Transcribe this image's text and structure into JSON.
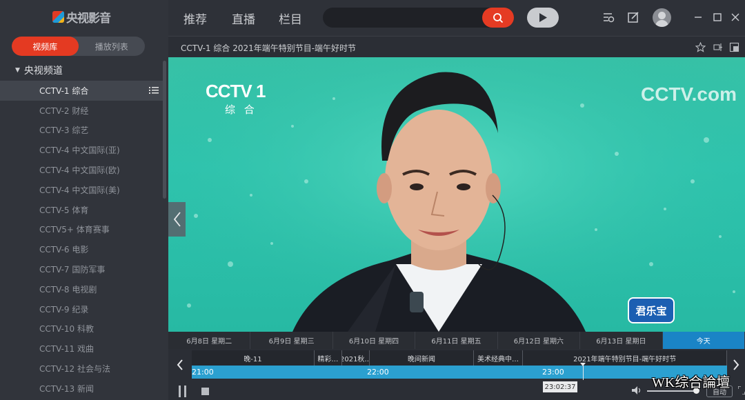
{
  "app": {
    "logo_text": "央视影音"
  },
  "sidebar": {
    "tabs": [
      {
        "label": "视频库",
        "active": true
      },
      {
        "label": "播放列表",
        "active": false
      }
    ],
    "group": "央视频道",
    "channels": [
      {
        "label": "CCTV-1 综合",
        "active": true
      },
      {
        "label": "CCTV-2 财经"
      },
      {
        "label": "CCTV-3 综艺"
      },
      {
        "label": "CCTV-4 中文国际(亚)"
      },
      {
        "label": "CCTV-4 中文国际(欧)"
      },
      {
        "label": "CCTV-4 中文国际(美)"
      },
      {
        "label": "CCTV-5 体育"
      },
      {
        "label": "CCTV5+ 体育赛事"
      },
      {
        "label": "CCTV-6 电影"
      },
      {
        "label": "CCTV-7 国防军事"
      },
      {
        "label": "CCTV-8 电视剧"
      },
      {
        "label": "CCTV-9 纪录"
      },
      {
        "label": "CCTV-10 科教"
      },
      {
        "label": "CCTV-11 戏曲"
      },
      {
        "label": "CCTV-12 社会与法"
      },
      {
        "label": "CCTV-13 新闻"
      }
    ]
  },
  "topnav": {
    "items": [
      "推荐",
      "直播",
      "栏目"
    ]
  },
  "player": {
    "title": "CCTV-1 综合 2021年端午特别节目-端午好时节",
    "watermark_channel": "CCTV 1",
    "watermark_sub": "综 合",
    "watermark_right": "CCTV.com",
    "brand_badge": "君乐宝"
  },
  "timeline": {
    "dates": [
      {
        "label": "6月8日 星期二"
      },
      {
        "label": "6月9日 星期三"
      },
      {
        "label": "6月10日 星期四"
      },
      {
        "label": "6月11日 星期五"
      },
      {
        "label": "6月12日 星期六"
      },
      {
        "label": "6月13日 星期日"
      },
      {
        "label": "今天",
        "today": true
      }
    ],
    "programs": [
      {
        "label": "晚-11",
        "flex": 4.5
      },
      {
        "label": "精彩…",
        "flex": 1
      },
      {
        "label": "2021秋…",
        "flex": 1
      },
      {
        "label": "晚间新闻",
        "flex": 3.8
      },
      {
        "label": "美术经典中…",
        "flex": 1.8
      },
      {
        "label": "2021年端午特别节目-端午好时节",
        "flex": 7.5
      }
    ],
    "times": [
      "21:00",
      "22:00",
      "23:00"
    ],
    "current_time": "23:02:37"
  },
  "controls": {
    "auto_label": "自动"
  },
  "overlay": {
    "forum_watermark": "WK综合論壇"
  }
}
